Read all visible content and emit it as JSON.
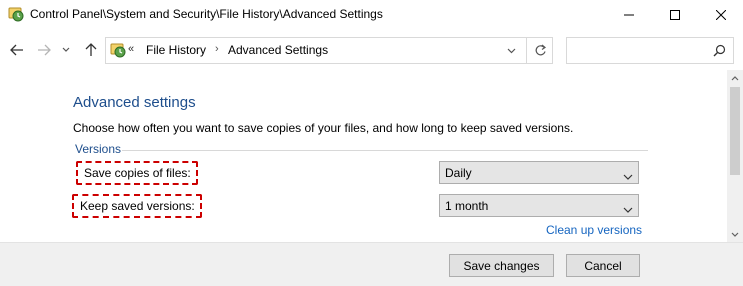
{
  "window": {
    "title": "Control Panel\\System and Security\\File History\\Advanced Settings",
    "icon": "file-history-icon"
  },
  "address": {
    "overflow": "«",
    "crumbs": [
      "File History",
      "Advanced Settings"
    ],
    "separator": "›"
  },
  "search": {
    "placeholder": ""
  },
  "main": {
    "title": "Advanced settings",
    "description": "Choose how often you want to save copies of your files, and how long to keep saved versions.",
    "group_label": "Versions",
    "save_copies_label": "Save copies of files:",
    "save_copies_value": "Daily",
    "keep_versions_label": "Keep saved versions:",
    "keep_versions_value": "1 month",
    "cleanup_link": "Clean up versions"
  },
  "footer": {
    "save_label": "Save changes",
    "cancel_label": "Cancel"
  },
  "colors": {
    "heading": "#1e4e8c",
    "link": "#1565c0",
    "highlight_dash": "#cc0000",
    "footer_bg": "#f0f0f0"
  }
}
